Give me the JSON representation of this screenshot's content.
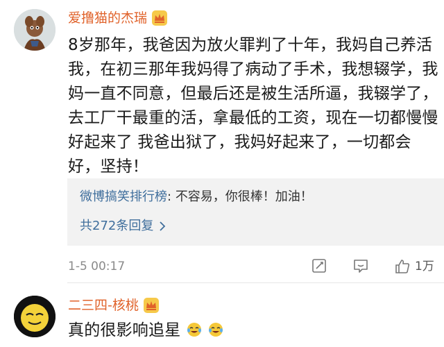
{
  "comments": [
    {
      "username": "爱撸猫的杰瑞",
      "content": "8岁那年，我爸因为放火罪判了十年，我妈自己养活我，在初三那年我妈得了病动了手术，我想辍学，我妈一直不同意，但最后还是被生活所逼，我辍学了，去工厂干最重的活，拿最低的工资，现在一切都慢慢好起来了 我爸出狱了，我妈好起来了，一切都会好，坚持！",
      "reply": {
        "username": "微博搞笑排行榜",
        "separator": ":",
        "text": "不容易，你很棒！加油！",
        "count_label": "共272条回复"
      },
      "timestamp": "1-5 00:17",
      "like_count": "1万"
    },
    {
      "username": "二三四-核桃",
      "content": "真的很影响追星"
    }
  ],
  "icons": {
    "crown": "crown-icon",
    "edit": "edit-icon",
    "reply": "comment-icon",
    "like": "thumbs-up-icon",
    "emoji": "laugh-cry-emoji"
  },
  "colors": {
    "username": "#e0622a",
    "link": "#3f6e9c",
    "meta": "#8a8a8a",
    "reply_bg": "#f2f2f2"
  }
}
